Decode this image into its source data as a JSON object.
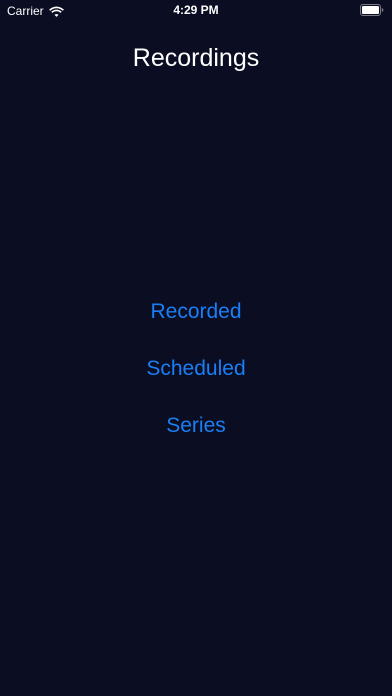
{
  "status_bar": {
    "carrier": "Carrier",
    "time": "4:29 PM",
    "wifi_icon": "wifi-icon",
    "battery_icon": "battery-icon"
  },
  "title": "Recordings",
  "menu": {
    "accent_color": "#1a7ef4",
    "items": [
      {
        "label": "Recorded"
      },
      {
        "label": "Scheduled"
      },
      {
        "label": "Series"
      }
    ]
  },
  "theme": {
    "background": "#0b0d22",
    "text": "#ffffff"
  }
}
